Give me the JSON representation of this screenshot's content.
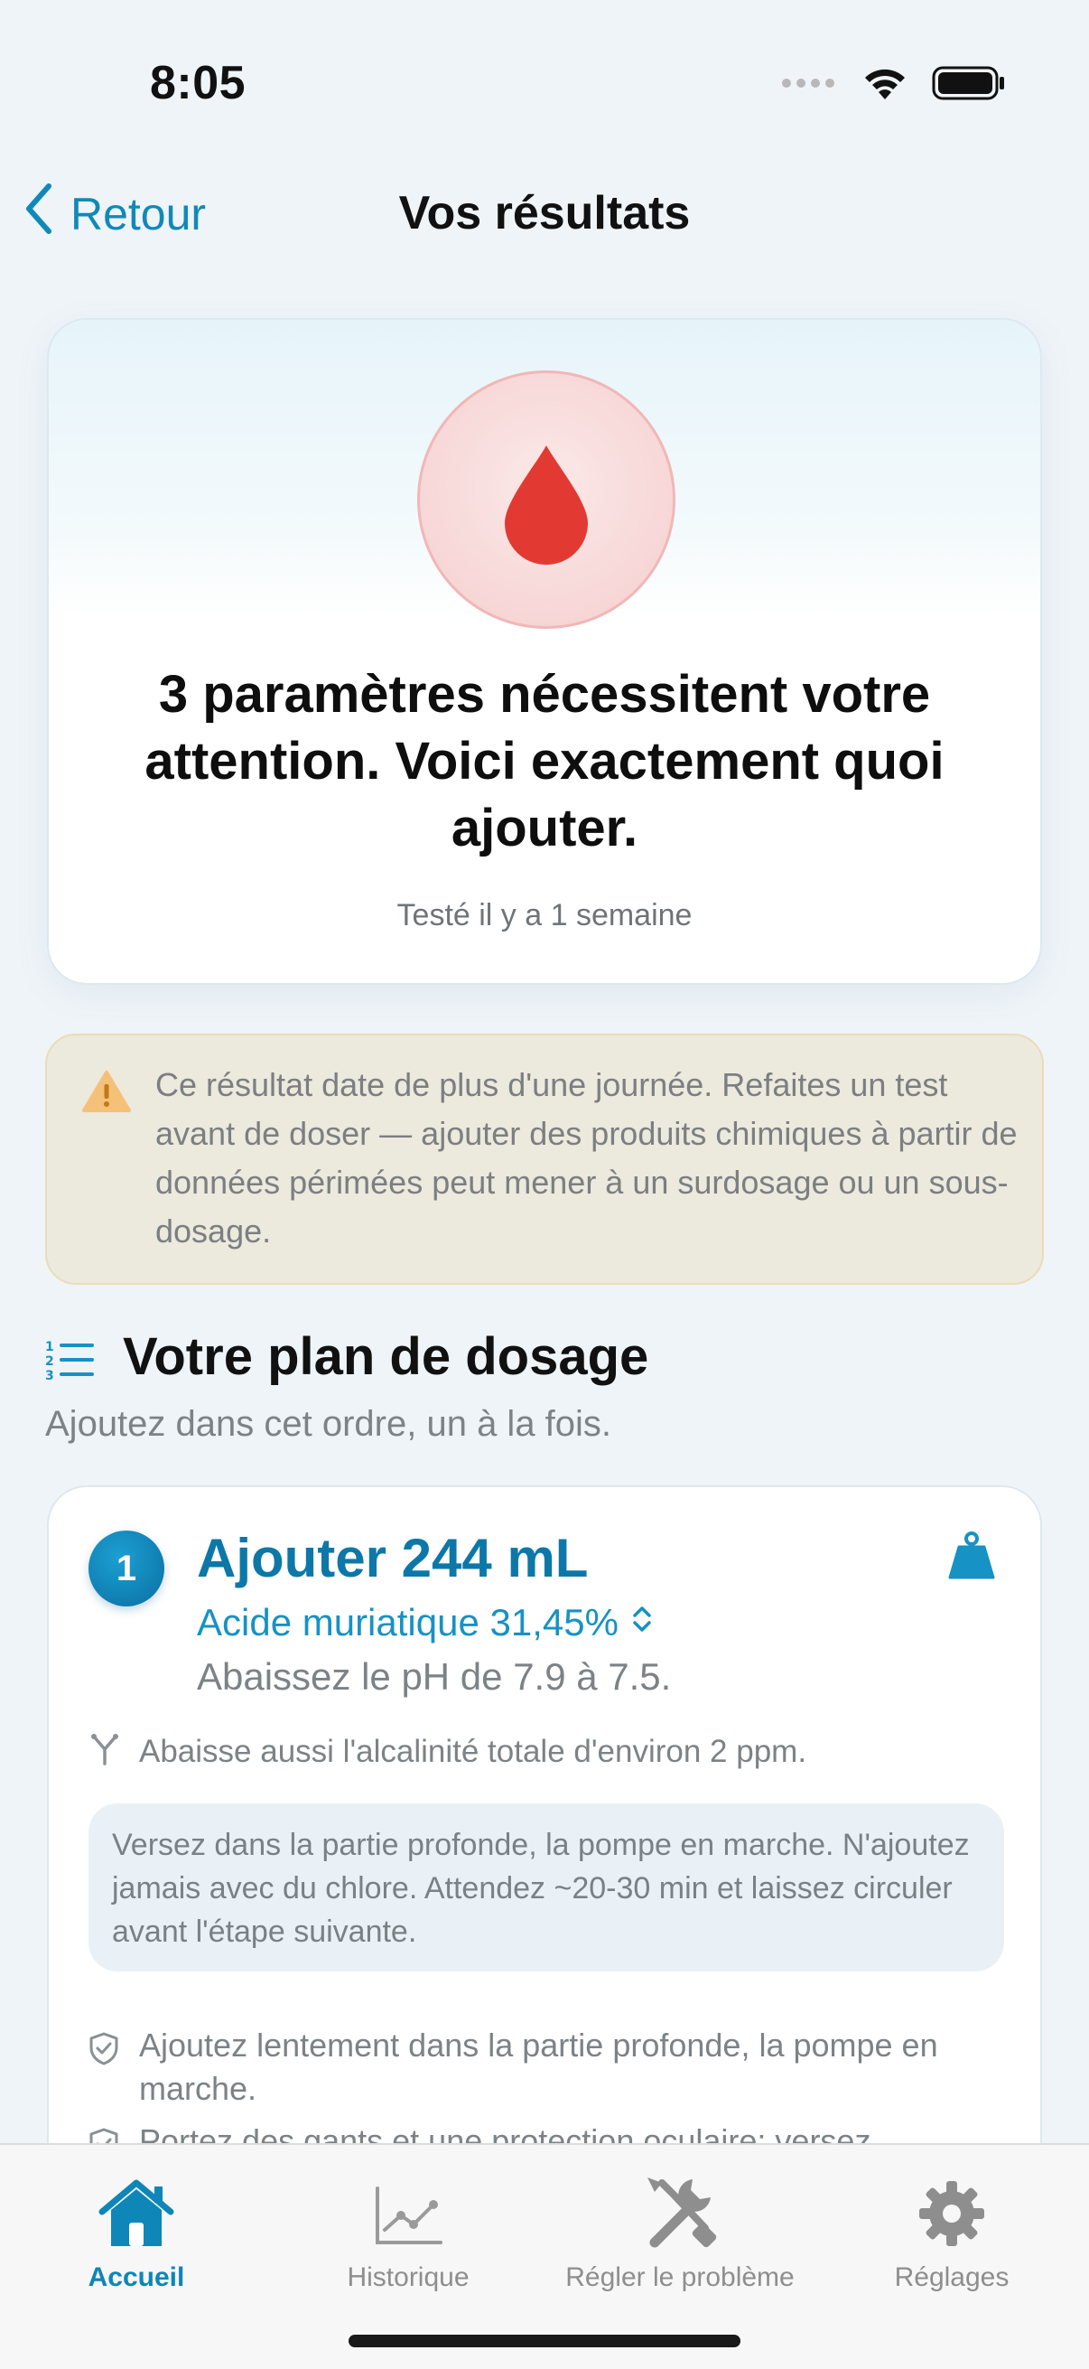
{
  "status_bar": {
    "time": "8:05"
  },
  "nav": {
    "back_label": "Retour",
    "title": "Vos résultats"
  },
  "hero": {
    "icon": "drop-icon",
    "title": "3 paramètres nécessitent votre attention. Voici exactement quoi ajouter.",
    "subtitle": "Testé il y a 1 semaine"
  },
  "warning": {
    "icon": "warning-icon",
    "text": "Ce résultat date de plus d'une journée. Refaites un test avant de doser — ajouter des produits chimiques à partir de données périmées peut mener à un surdosage ou un sous-dosage."
  },
  "dosing_plan": {
    "title": "Votre plan de dosage",
    "subtitle": "Ajoutez dans cet ordre, un à la fois.",
    "steps": [
      {
        "number": "1",
        "amount": "Ajouter 244 mL",
        "product": "Acide muriatique 31,45%",
        "effect": "Abaissez le pH de 7.9 à 7.5.",
        "side_effect": "Abaisse aussi l'alcalinité totale d'environ 2 ppm.",
        "instructions": "Versez dans la partie profonde, la pompe en marche. N'ajoutez jamais avec du chlore. Attendez ~20-30 min et laissez circuler avant l'étape suivante.",
        "safety": [
          "Ajoutez lentement dans la partie profonde, la pompe en marche.",
          "Portez des gants et une protection oculaire; versez"
        ]
      }
    ]
  },
  "tabs": [
    {
      "label": "Accueil",
      "icon": "house-icon",
      "active": true
    },
    {
      "label": "Historique",
      "icon": "chart-icon",
      "active": false
    },
    {
      "label": "Régler le problème",
      "icon": "tools-icon",
      "active": false
    },
    {
      "label": "Réglages",
      "icon": "gear-icon",
      "active": false
    }
  ],
  "colors": {
    "accent": "#0e86b8",
    "drop_red": "#e23a32",
    "warning_bg": "#ece9dd"
  }
}
